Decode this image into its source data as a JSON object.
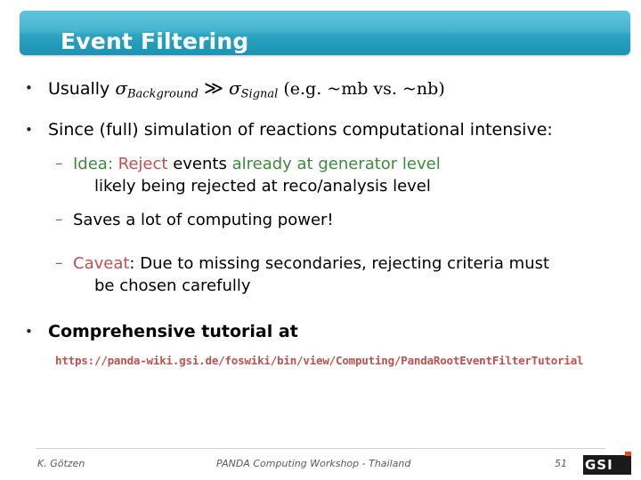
{
  "slide": {
    "title": "Event Filtering",
    "accent_color": "#2da3c0",
    "bullets": {
      "b1_mark": "•",
      "b1_prefix": "Usually",
      "b1_sigma_bg": "σ",
      "b1_sigma_bg_sub": "Background",
      "b1_gg": "≫",
      "b1_sigma_sig": "σ",
      "b1_sigma_sig_sub": "Signal",
      "b1_suffix": "(e.g. ~mb vs. ~nb)",
      "b2_mark": "•",
      "b2_text": "Since (full) simulation of reactions computational intensive:",
      "b3_mark": "–",
      "b3_idea_label": "Idea:",
      "b3_reject": "Reject",
      "b3_mid": "events",
      "b3_green": "already at generator level",
      "b3_line2": "likely being rejected at reco/analysis level",
      "b4_mark": "–",
      "b4_text": "Saves a lot of computing power!",
      "b5_mark": "–",
      "b5_caveat_label": "Caveat",
      "b5_text": ": Due to missing secondaries, rejecting criteria must",
      "b5_line2": "be chosen carefully",
      "b6_mark": "•",
      "b6_text": "Comprehensive tutorial at",
      "url": "https://panda-wiki.gsi.de/foswiki/bin/view/Computing/PandaRootEventFilterTutorial"
    }
  },
  "footer": {
    "author": "K. Götzen",
    "center": "PANDA Computing Workshop - Thailand",
    "page": "51",
    "logo_text": "GSI"
  }
}
